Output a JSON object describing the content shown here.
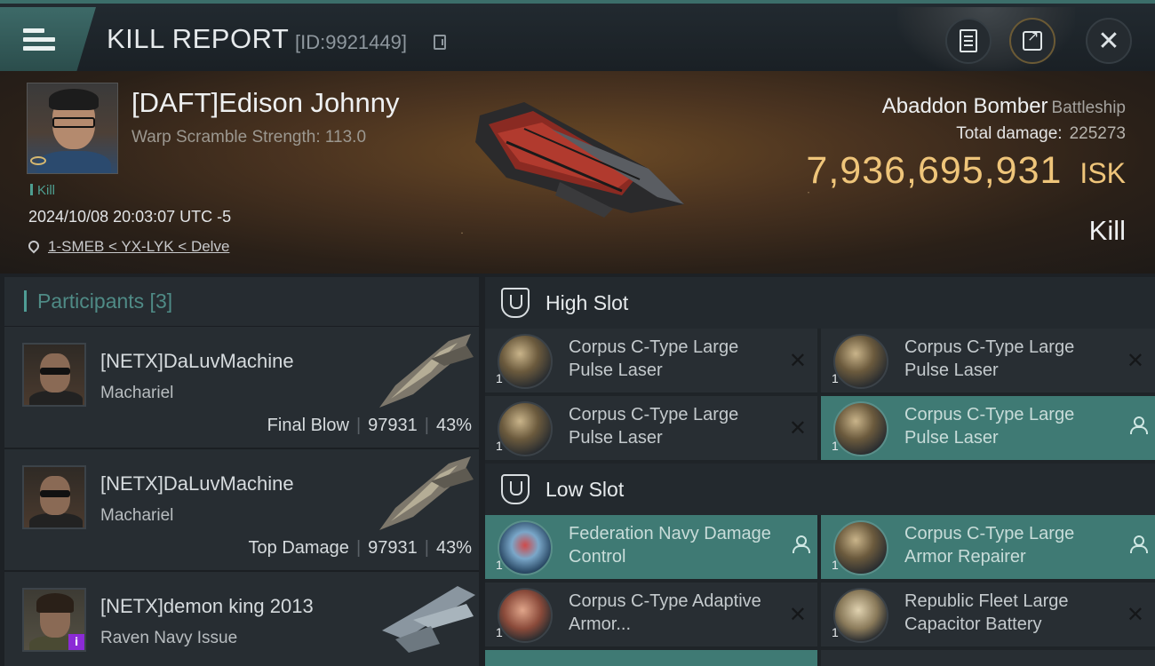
{
  "header": {
    "title": "KILL REPORT",
    "report_id": "[ID:9921449]"
  },
  "victim": {
    "name": "[DAFT]Edison Johnny",
    "warp_scramble": "Warp Scramble Strength: 113.0",
    "tag": "Kill",
    "datetime": "2024/10/08 20:03:07 UTC -5",
    "location": "1-SMEB < YX-LYK < Delve"
  },
  "ship": {
    "name": "Abaddon Bomber",
    "class": "Battleship",
    "total_damage_label": "Total damage:",
    "total_damage_value": "225273",
    "isk_value": "7,936,695,931",
    "isk_unit": "ISK",
    "result": "Kill"
  },
  "participants": {
    "title": "Participants [3]",
    "items": [
      {
        "name": "[NETX]DaLuvMachine",
        "ship": "Machariel",
        "role": "Final Blow",
        "damage": "97931",
        "percent": "43%"
      },
      {
        "name": "[NETX]DaLuvMachine",
        "ship": "Machariel",
        "role": "Top Damage",
        "damage": "97931",
        "percent": "43%"
      },
      {
        "name": "[NETX]demon king 2013",
        "ship": "Raven Navy Issue",
        "badge": "i"
      }
    ]
  },
  "fitting": {
    "high_slot": {
      "label": "High Slot",
      "modules": [
        {
          "count": "1",
          "name": "Corpus C-Type Large Pulse Laser",
          "state": "destroyed"
        },
        {
          "count": "1",
          "name": "Corpus C-Type Large Pulse Laser",
          "state": "destroyed"
        },
        {
          "count": "1",
          "name": "Corpus C-Type Large Pulse Laser",
          "state": "destroyed"
        },
        {
          "count": "1",
          "name": "Corpus C-Type Large Pulse Laser",
          "state": "dropped"
        }
      ]
    },
    "low_slot": {
      "label": "Low Slot",
      "modules": [
        {
          "count": "1",
          "name": "Federation Navy Damage Control",
          "state": "dropped"
        },
        {
          "count": "1",
          "name": "Corpus C-Type Large Armor Repairer",
          "state": "dropped"
        },
        {
          "count": "1",
          "name": "Corpus C-Type Adaptive Armor...",
          "state": "destroyed"
        },
        {
          "count": "1",
          "name": "Republic Fleet Large Capacitor Battery",
          "state": "destroyed"
        }
      ]
    }
  },
  "icons": {
    "menu": "menu-icon",
    "copy": "copy-icon",
    "clipboard": "clipboard-icon",
    "share": "share-icon",
    "close": "close-icon",
    "location": "location-pin-icon",
    "slot": "shield-slot-icon",
    "destroyed": "x-icon",
    "dropped": "person-icon"
  },
  "colors": {
    "accent_teal": "#3f7a74",
    "isk_gold": "#efc57a",
    "kill_tag": "#4e9e90"
  }
}
